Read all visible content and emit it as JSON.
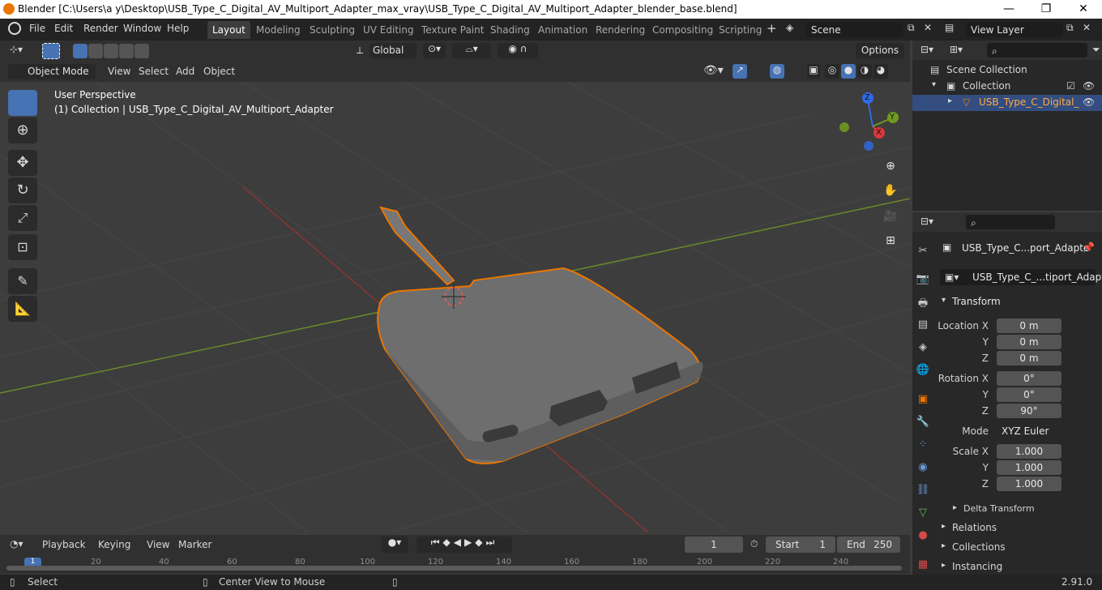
{
  "window": {
    "title": "Blender [C:\\Users\\a y\\Desktop\\USB_Type_C_Digital_AV_Multiport_Adapter_max_vray\\USB_Type_C_Digital_AV_Multiport_Adapter_blender_base.blend]",
    "minimize": "—",
    "maximize": "❐",
    "close": "✕"
  },
  "menu": [
    "File",
    "Edit",
    "Render",
    "Window",
    "Help"
  ],
  "workspaces": [
    "Layout",
    "Modeling",
    "Sculpting",
    "UV Editing",
    "Texture Paint",
    "Shading",
    "Animation",
    "Rendering",
    "Compositing",
    "Scripting"
  ],
  "active_workspace": "Layout",
  "scene": {
    "label": "Scene"
  },
  "view_layer": {
    "label": "View Layer"
  },
  "toolbar": {
    "orientation": "Global",
    "options": "Options"
  },
  "viewport_header": {
    "mode": "Object Mode",
    "items": [
      "View",
      "Select",
      "Add",
      "Object"
    ]
  },
  "viewport": {
    "perspective": "User Perspective",
    "collection_info": "(1) Collection | USB_Type_C_Digital_AV_Multiport_Adapter",
    "gizmo": {
      "x": "X",
      "y": "Y",
      "z": "Z"
    }
  },
  "outliner": {
    "rows": [
      "Scene Collection",
      "Collection",
      "USB_Type_C_Digital_"
    ]
  },
  "properties": {
    "object_name": "USB_Type_C...port_Adapte",
    "mesh_name": "USB_Type_C_...tiport_Adapter",
    "transform_header": "Transform",
    "location": {
      "label": "Location X",
      "y_label": "Y",
      "z_label": "Z",
      "x": "0 m",
      "y": "0 m",
      "z": "0 m"
    },
    "rotation": {
      "label": "Rotation X",
      "y_label": "Y",
      "z_label": "Z",
      "x": "0°",
      "y": "0°",
      "z": "90°"
    },
    "mode": {
      "label": "Mode",
      "value": "XYZ Euler"
    },
    "scale": {
      "label": "Scale X",
      "y_label": "Y",
      "z_label": "Z",
      "x": "1.000",
      "y": "1.000",
      "z": "1.000"
    },
    "sections": [
      "Delta Transform",
      "Relations",
      "Collections",
      "Instancing"
    ]
  },
  "timeline": {
    "items": [
      "Playback",
      "Keying",
      "View",
      "Marker"
    ],
    "current_frame": "1",
    "start_label": "Start",
    "start": "1",
    "end_label": "End",
    "end": "250",
    "ruler": [
      "1",
      "20",
      "40",
      "60",
      "80",
      "100",
      "120",
      "140",
      "160",
      "180",
      "200",
      "220",
      "240"
    ]
  },
  "statusbar": {
    "select": "Select",
    "center": "Center View to Mouse",
    "version": "2.91.0"
  },
  "colors": {
    "accent": "#4772b3",
    "selection": "#ea7600",
    "header": "#303030",
    "panel": "#282828",
    "viewport": "#3d3d3d"
  }
}
